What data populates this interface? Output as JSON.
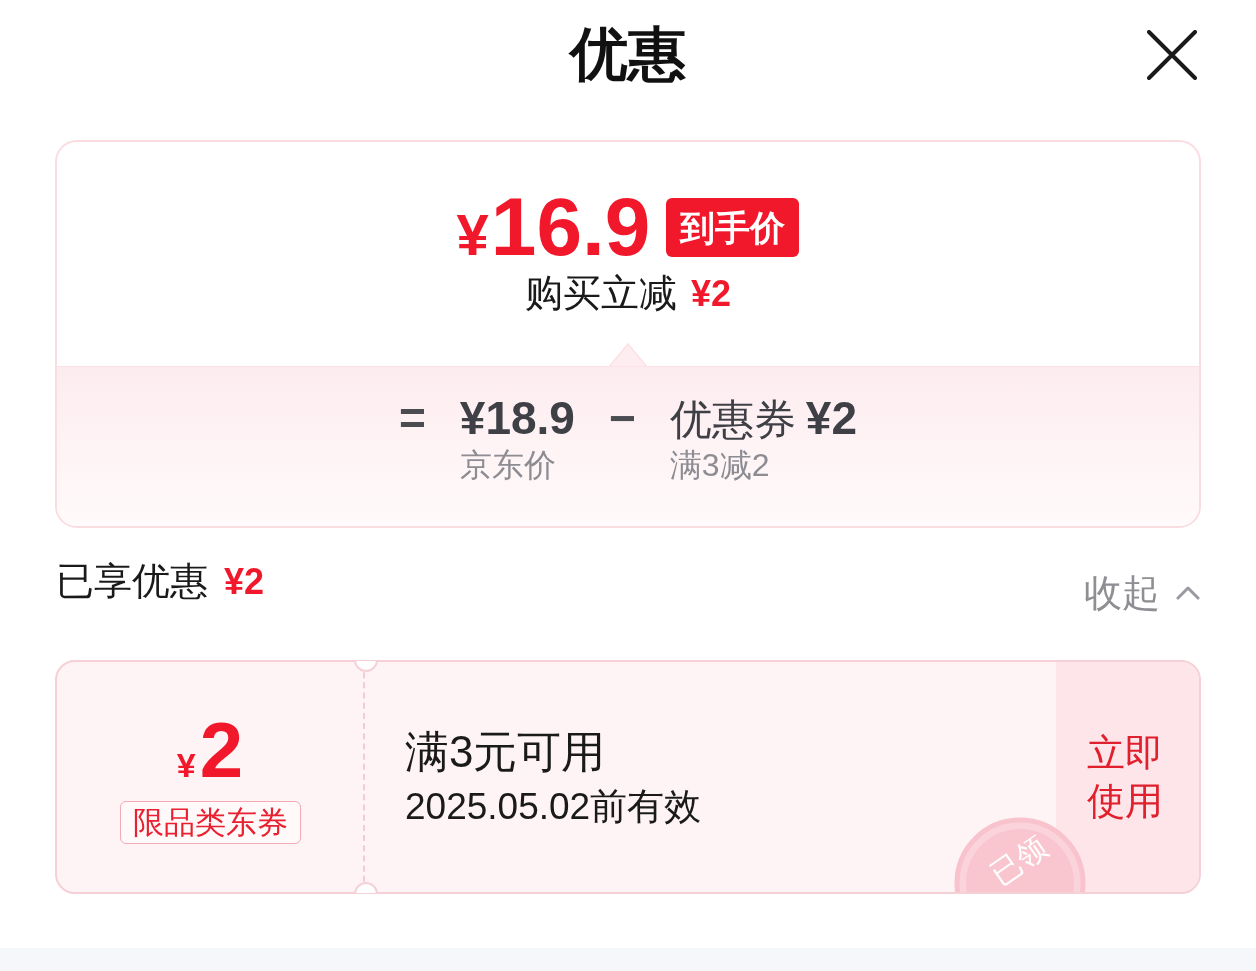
{
  "header": {
    "title": "优惠"
  },
  "price_card": {
    "final_price": {
      "currency": "¥",
      "amount": "16.9"
    },
    "badge": "到手价",
    "instant_discount": {
      "label": "购买立减",
      "amount": "¥2"
    },
    "breakdown": [
      {
        "kind": "operator",
        "value": "="
      },
      {
        "kind": "amount",
        "value": "¥18.9",
        "caption": "京东价"
      },
      {
        "kind": "operator",
        "value": "−"
      },
      {
        "kind": "amount",
        "label": "优惠券",
        "value": "¥2",
        "caption": "满3减2"
      }
    ]
  },
  "enjoyed": {
    "label": "已享优惠",
    "amount": "¥2",
    "toggle": {
      "label": "收起",
      "expanded": true
    }
  },
  "coupons": [
    {
      "currency": "¥",
      "amount": "2",
      "tag": "限品类东券",
      "condition": "满3元可用",
      "validity": "2025.05.02前有效",
      "action": "立即使用",
      "claimed": true,
      "stamp": "已领"
    }
  ]
}
